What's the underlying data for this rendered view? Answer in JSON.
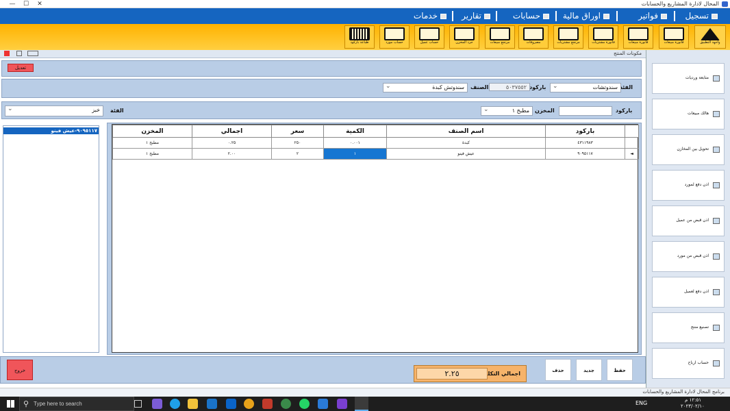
{
  "window": {
    "title": "المحال لادارة المشاريع والحسابات",
    "minimize": "—",
    "restore": "☐",
    "close": "✕"
  },
  "menu": [
    {
      "label": "تسجيل"
    },
    {
      "label": "فواتير"
    },
    {
      "label": "اوراق مالية"
    },
    {
      "label": "حسابات"
    },
    {
      "label": "تقارير"
    },
    {
      "label": "خدمات"
    }
  ],
  "toolbar": [
    {
      "label": "واجهة التطبيق",
      "icon": "home-icon"
    },
    {
      "label": "فاتورة مبيعات",
      "icon": "pos-icon"
    },
    {
      "label": "فاتورة مبيعات",
      "icon": "calculator-icon"
    },
    {
      "label": "فاتورة مشتريات",
      "icon": "truck-icon"
    },
    {
      "label": "مرتجع مشتريات",
      "icon": "return-icon"
    },
    {
      "label": "مرتجع مبيعات",
      "icon": "return-icon"
    },
    {
      "label": "مصروفات",
      "icon": "document-icon"
    },
    {
      "label": "جرد المخزن",
      "icon": "inventory-icon"
    },
    {
      "label": "حساب عميل",
      "icon": "certificate-icon"
    },
    {
      "label": "حساب مورد",
      "icon": "monitor-icon"
    },
    {
      "label": "طباعة باركود",
      "icon": "barcode-icon"
    }
  ],
  "form_title": "مكونات المنتج",
  "edit_button": "تعديل",
  "category_label": "الفئة",
  "category_value": "سندوتشات",
  "barcode_label": "باركود",
  "barcode_value": "٥٠٣٧٥٥٢",
  "item_label": "الصنف",
  "item_value": "سندوتش كبدة",
  "barcode2_label": "باركود",
  "barcode2_value": "",
  "store_label": "المخزن",
  "store_value": "مطبخ ١",
  "category2_label": "الفئة",
  "category2_value": "خبز",
  "list_items": [
    "٩٠٩٥١١٧-عيش فينو"
  ],
  "grid": {
    "headers": [
      "باركود",
      "اسم الصنف",
      "الكمية",
      "سعر",
      "اجمالي",
      "المخزن"
    ],
    "rows": [
      [
        "٤٣١١٩٨٣",
        "كبدة",
        "٠.٠٠١",
        "٢٥٠",
        "٠.٢٥",
        "مطبخ ١"
      ],
      [
        "٩٠٩٥١١٧",
        "عيش فينو",
        "١",
        "٢",
        "٢.٠٠",
        "مطبخ ١"
      ]
    ],
    "current_row": 1
  },
  "side_buttons": [
    {
      "label": "متابعة ورديات"
    },
    {
      "label": "هالك مبيعات"
    },
    {
      "label": "تحويل بين المخازن"
    },
    {
      "label": "اذن دفع لمورد"
    },
    {
      "label": "اذن قبض من عميل"
    },
    {
      "label": "اذن قبض من مورد"
    },
    {
      "label": "اذن دفع لعميل"
    },
    {
      "label": "تصنيع منتج"
    },
    {
      "label": "حساب ارباح"
    }
  ],
  "actions": {
    "save": "حفظ",
    "new": "جديد",
    "delete": "حذف",
    "exit": "خروج"
  },
  "total_label": "اجمالي التكلفة",
  "total_value": "٢.٢٥",
  "statusbar_text": "برنامج المحال لادارة المشاريع والحسابات",
  "taskbar": {
    "search_placeholder": "Type here to search",
    "language": "ENG",
    "time": "١٢:٥١ م",
    "date": "٢٠٢٣/٠٢/١٠"
  }
}
